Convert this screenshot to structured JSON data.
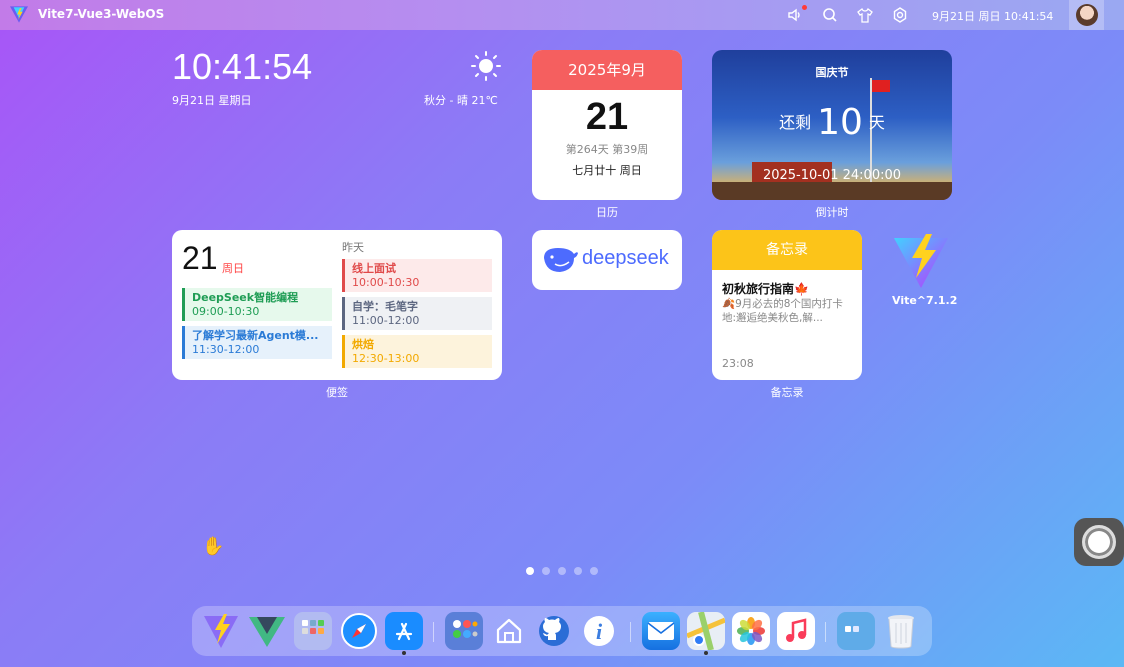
{
  "topbar": {
    "app_title": "Vite7-Vue3-WebOS",
    "datetime": "9月21日 周日 10:41:54",
    "icons": [
      "volume-icon",
      "search-icon",
      "shirt-icon",
      "settings-icon"
    ]
  },
  "clock": {
    "time": "10:41:54",
    "date": "9月21日 星期日",
    "weather": "秋分 - 晴 21℃",
    "weather_icon": "sun-icon"
  },
  "calendar": {
    "month": "2025年9月",
    "day": "21",
    "sub": "第264天 第39周",
    "lunar": "七月廿十 周日",
    "label": "日历",
    "header_color": "#f55f5f"
  },
  "countdown": {
    "title": "国庆节",
    "prefix": "还剩",
    "days": "10",
    "suffix": "天",
    "target": "2025-10-01 24:00:00",
    "label": "倒计时"
  },
  "schedule": {
    "day": "21",
    "weekday": "周日",
    "yesterday": "昨天",
    "label": "便签",
    "today_events": [
      {
        "title": "DeepSeek智能编程",
        "time": "09:00-10:30",
        "color": "#1f9d55",
        "bg": "#e6f9ec"
      },
      {
        "title": "了解学习最新Agent模...",
        "time": "11:30-12:00",
        "color": "#2b7bd6",
        "bg": "#e6f1fb"
      }
    ],
    "yesterday_events": [
      {
        "title": "线上面试",
        "time": "10:00-10:30",
        "color": "#e04a4a",
        "bg": "#fdeaea"
      },
      {
        "title": "自学：毛笔字",
        "time": "11:00-12:00",
        "color": "#5c6680",
        "bg": "#eff1f4"
      },
      {
        "title": "烘焙",
        "time": "12:30-13:00",
        "color": "#f2a900",
        "bg": "#fdf3dc"
      }
    ]
  },
  "deepseek": {
    "text": "deepseek",
    "color": "#4d6bfe"
  },
  "memo": {
    "header": "备忘录",
    "title": "初秋旅行指南🍁",
    "body": "🍂9月必去的8个国内打卡地:邂逅绝美秋色,解...",
    "time": "23:08",
    "label": "备忘录",
    "header_color": "#fcc419"
  },
  "vite_app": {
    "label": "Vite^7.1.2"
  },
  "pages": {
    "count": 5,
    "active": 0
  },
  "dock": {
    "apps": [
      "vite-app",
      "vue-app",
      "app-folder",
      "safari-app",
      "app-store",
      "apps-grid",
      "home-app",
      "github-app",
      "info-app",
      "mail-app",
      "maps-app",
      "photos-app",
      "music-app",
      "folder-app",
      "trash-app"
    ]
  }
}
